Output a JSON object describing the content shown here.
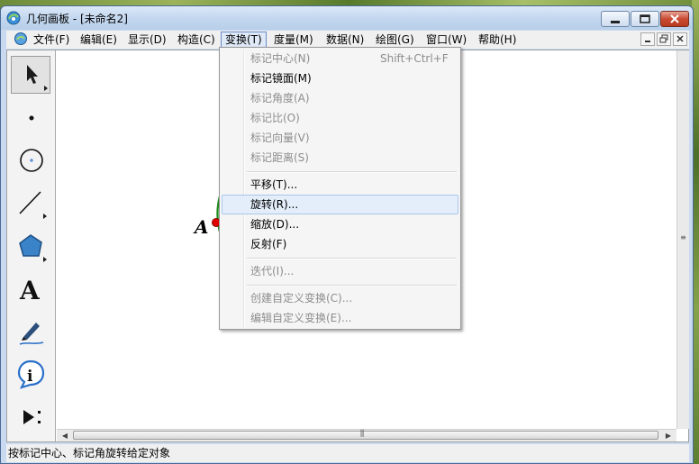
{
  "window": {
    "title": "几何画板 - [未命名2]",
    "status": "按标记中心、标记角旋转给定对象"
  },
  "menubar": {
    "items": [
      "文件(F)",
      "编辑(E)",
      "显示(D)",
      "构造(C)",
      "变换(T)",
      "度量(M)",
      "数据(N)",
      "绘图(G)",
      "窗口(W)",
      "帮助(H)"
    ]
  },
  "transform_menu": {
    "mark_center": "标记中心(N)",
    "mark_center_shortcut": "Shift+Ctrl+F",
    "mark_mirror": "标记镜面(M)",
    "mark_angle": "标记角度(A)",
    "mark_ratio": "标记比(O)",
    "mark_vector": "标记向量(V)",
    "mark_distance": "标记距离(S)",
    "translate": "平移(T)...",
    "rotate": "旋转(R)...",
    "dilate": "缩放(D)...",
    "reflect": "反射(F)",
    "iterate": "迭代(I)...",
    "create_custom": "创建自定义变换(C)...",
    "edit_custom": "编辑自定义变换(E)..."
  },
  "canvas": {
    "point_label": "A"
  },
  "colors": {
    "circle": "#1a8a1a",
    "point": "#e00000",
    "menu_highlight": "#e4eefb"
  },
  "icons": {
    "app": "geometer-sketchpad-icon",
    "tools": [
      "arrow-select-icon",
      "point-tool-icon",
      "compass-circle-icon",
      "straightedge-line-icon",
      "polygon-icon",
      "text-tool-icon",
      "marker-pen-icon",
      "information-icon",
      "custom-tool-icon"
    ]
  }
}
